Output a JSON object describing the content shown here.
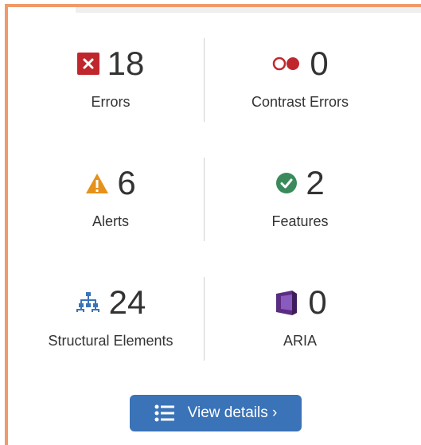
{
  "summary": {
    "items": [
      {
        "count": "18",
        "label": "Errors",
        "icon": "error-x-icon",
        "color": "#c0272d"
      },
      {
        "count": "0",
        "label": "Contrast Errors",
        "icon": "contrast-icon",
        "color": "#c0272d"
      },
      {
        "count": "6",
        "label": "Alerts",
        "icon": "alert-triangle-icon",
        "color": "#e5911b"
      },
      {
        "count": "2",
        "label": "Features",
        "icon": "check-circle-icon",
        "color": "#3a8a5c"
      },
      {
        "count": "24",
        "label": "Structural Elements",
        "icon": "structure-tree-icon",
        "color": "#3a73b7"
      },
      {
        "count": "0",
        "label": "ARIA",
        "icon": "aria-box-icon",
        "color": "#5a2d82"
      }
    ]
  },
  "actions": {
    "view_details_label": "View details ›"
  },
  "colors": {
    "frame_border": "#ee9a69",
    "button_bg": "#3a73b7",
    "text": "#333333"
  }
}
